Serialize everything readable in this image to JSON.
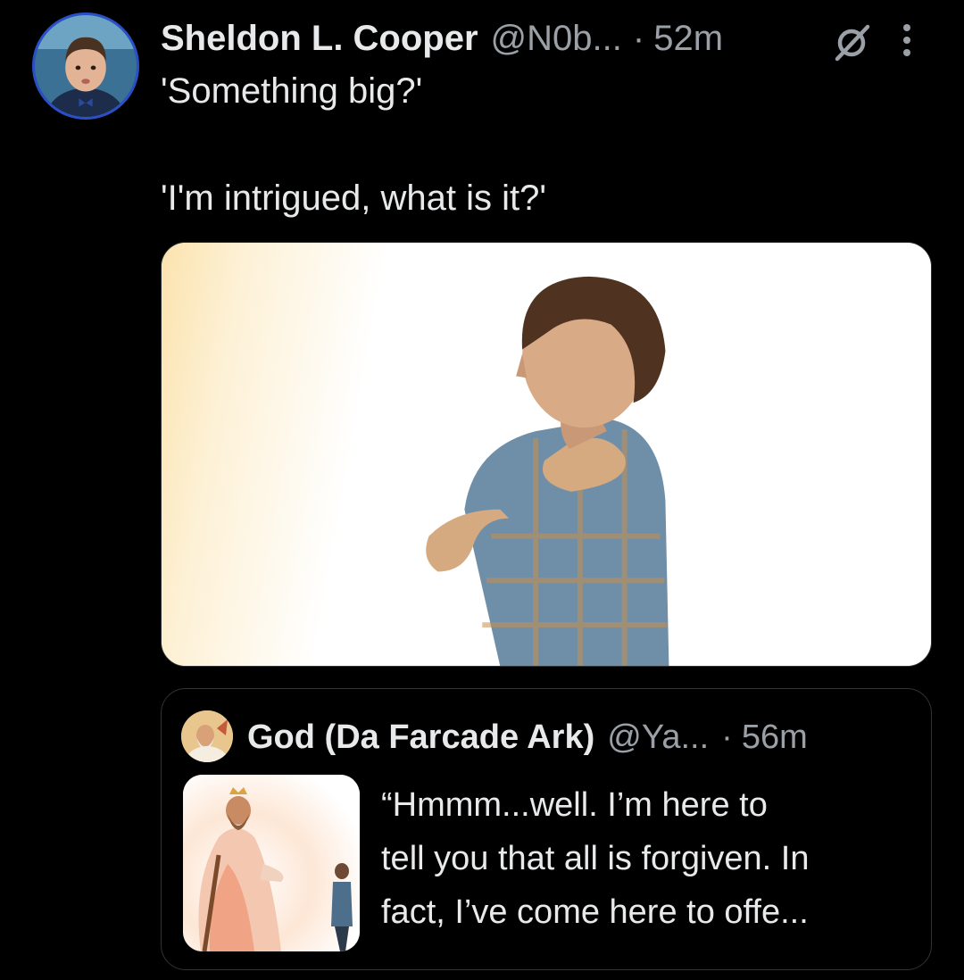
{
  "tweet": {
    "author": {
      "display_name": "Sheldon L. Cooper",
      "handle": "@N0b...",
      "avatar": "avatar-photo"
    },
    "separator": "·",
    "timestamp": "52m",
    "icons": {
      "grok": "grok-slash-icon",
      "more": "more-vertical-icon"
    },
    "text_lines": [
      "'Something big?'",
      "'I'm intrigued, what is it?'"
    ],
    "media": {
      "type": "image"
    }
  },
  "quote": {
    "author": {
      "display_name": "God (Da Farcade Ark)",
      "handle": "@Ya...",
      "avatar": "avatar-photo"
    },
    "separator": "·",
    "timestamp": "56m",
    "text_lines": [
      "“Hmmm...well. I’m here to",
      "tell you that all is forgiven. In",
      "fact, I’ve come here to offe..."
    ]
  },
  "colors": {
    "background": "#000000",
    "primary_text": "#e7e9ea",
    "secondary_text": "#9aa0a6",
    "border": "#2f3336",
    "avatar_ring": "#2a50c8"
  }
}
